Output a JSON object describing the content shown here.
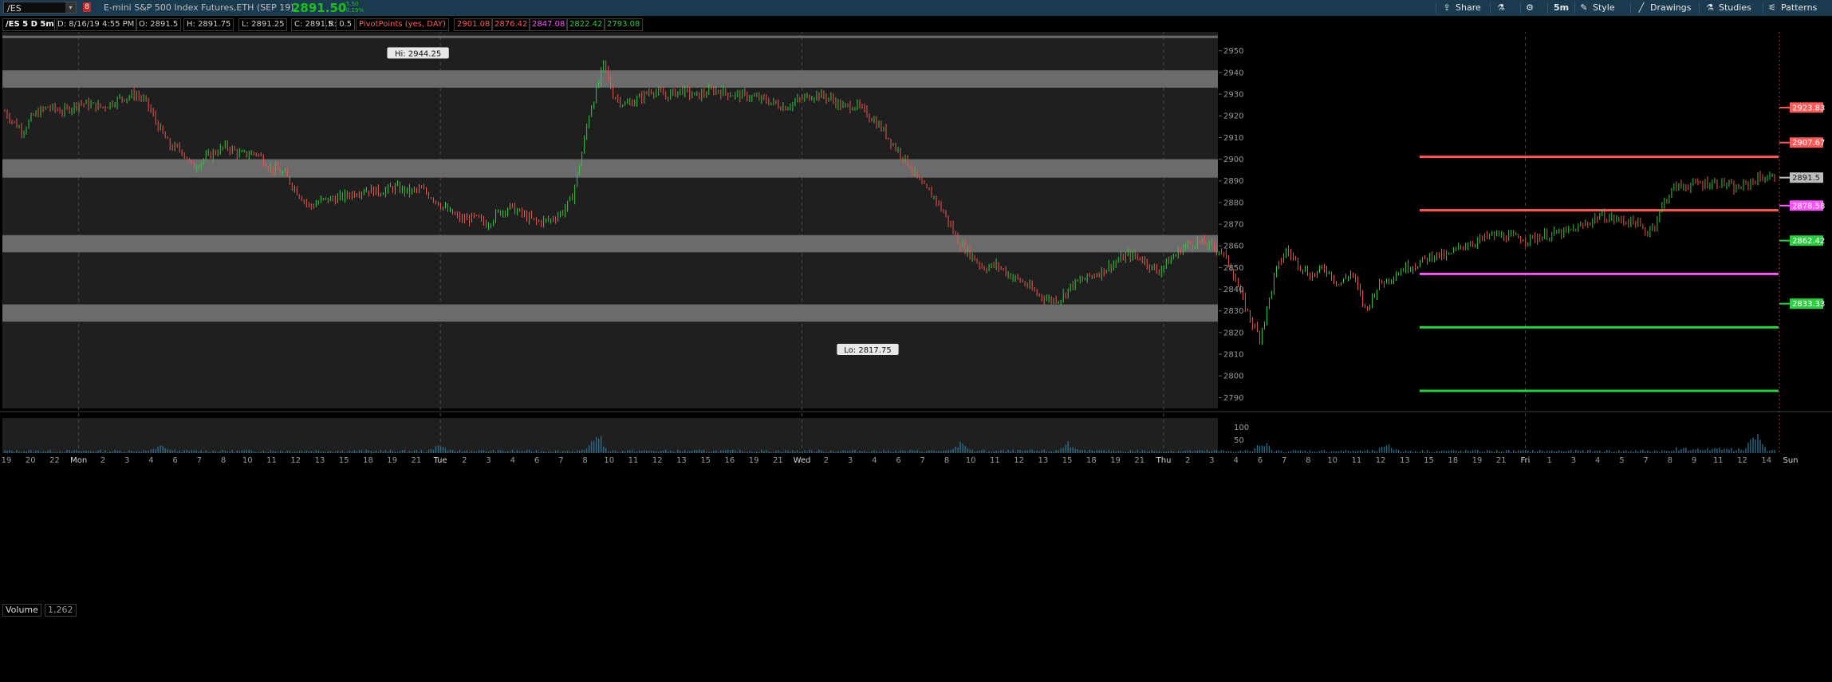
{
  "toolbar": {
    "symbol": "/ES",
    "link_indicator": "8",
    "description": "E-mini S&P 500 Index Futures,ETH (SEP 19)",
    "last_price": "2891.50",
    "net_change": "+5.50",
    "net_change_pct": "+0.19%",
    "share_label": "Share",
    "timeframe_label": "5m",
    "style_label": "Style",
    "drawings_label": "Drawings",
    "studies_label": "Studies",
    "patterns_label": "Patterns"
  },
  "info_bar": {
    "title": "/ES 5 D 5m",
    "date": "D: 8/16/19 4:55 PM",
    "open": "O: 2891.5",
    "high": "H: 2891.75",
    "low": "L: 2891.25",
    "close": "C: 2891.5",
    "range": "R: 0.5",
    "study_name": "PivotPoints (yes, DAY)",
    "pivot_values": [
      {
        "text": "2901.08",
        "color": "#ff5a5a"
      },
      {
        "text": "2876.42",
        "color": "#ff5a5a"
      },
      {
        "text": "2847.08",
        "color": "#ff55ff"
      },
      {
        "text": "2822.42",
        "color": "#2ecc40"
      },
      {
        "text": "2793.08",
        "color": "#2ecc40"
      }
    ]
  },
  "chart_data": {
    "type": "candlestick",
    "symbol": "/ES",
    "interval": "5m",
    "ylim": [
      2785,
      2958
    ],
    "y_ticks": [
      2790,
      2800,
      2810,
      2820,
      2830,
      2840,
      2850,
      2860,
      2870,
      2880,
      2890,
      2900,
      2910,
      2920,
      2930,
      2940,
      2950
    ],
    "grid": "dashed session separators",
    "x_tick_labels": [
      "19",
      "20",
      "22",
      "Mon",
      "2",
      "3",
      "4",
      "6",
      "7",
      "8",
      "10",
      "11",
      "12",
      "13",
      "15",
      "18",
      "19",
      "21",
      "Tue",
      "2",
      "3",
      "4",
      "6",
      "7",
      "8",
      "10",
      "11",
      "12",
      "13",
      "15",
      "16",
      "19",
      "21",
      "Wed",
      "2",
      "3",
      "4",
      "6",
      "7",
      "8",
      "10",
      "11",
      "12",
      "13",
      "15",
      "18",
      "19",
      "21",
      "Thu",
      "2",
      "3",
      "4",
      "6",
      "7",
      "8",
      "10",
      "11",
      "12",
      "13",
      "15",
      "18",
      "19",
      "21",
      "Fri",
      "1",
      "3",
      "4",
      "5",
      "7",
      "8",
      "9",
      "11",
      "12",
      "14",
      "Sun"
    ],
    "session_labels": [
      "Mon",
      "Tue",
      "Wed",
      "Thu",
      "Fri"
    ],
    "price_path": [
      [
        0,
        2922
      ],
      [
        0.4,
        2918
      ],
      [
        1.0,
        2913
      ],
      [
        1.6,
        2920
      ],
      [
        2.4,
        2924
      ],
      [
        3.3,
        2922
      ],
      [
        4.2,
        2926
      ],
      [
        5.5,
        2924
      ],
      [
        6.5,
        2928
      ],
      [
        7.4,
        2930
      ],
      [
        8.0,
        2926
      ],
      [
        8.6,
        2916
      ],
      [
        9.3,
        2906
      ],
      [
        10.0,
        2904
      ],
      [
        10.6,
        2896
      ],
      [
        11.2,
        2900
      ],
      [
        11.8,
        2903
      ],
      [
        12.5,
        2906
      ],
      [
        13.3,
        2902
      ],
      [
        14.2,
        2903
      ],
      [
        15.0,
        2896
      ],
      [
        15.8,
        2893
      ],
      [
        16.5,
        2885
      ],
      [
        17.2,
        2878
      ],
      [
        17.9,
        2881
      ],
      [
        18.8,
        2882
      ],
      [
        19.5,
        2884
      ],
      [
        20.3,
        2886
      ],
      [
        21.2,
        2885
      ],
      [
        22.0,
        2887
      ],
      [
        22.8,
        2885
      ],
      [
        23.5,
        2886
      ],
      [
        24.2,
        2882
      ],
      [
        25.0,
        2876
      ],
      [
        25.8,
        2872
      ],
      [
        26.5,
        2873
      ],
      [
        27.2,
        2870
      ],
      [
        27.8,
        2875
      ],
      [
        28.5,
        2878
      ],
      [
        29.3,
        2874
      ],
      [
        30.0,
        2871
      ],
      [
        30.8,
        2872
      ],
      [
        31.5,
        2876
      ],
      [
        32.0,
        2882
      ],
      [
        32.5,
        2900
      ],
      [
        33.0,
        2922
      ],
      [
        33.4,
        2932
      ],
      [
        33.8,
        2944.25
      ],
      [
        34.3,
        2930
      ],
      [
        35.0,
        2925
      ],
      [
        35.8,
        2928
      ],
      [
        36.5,
        2932
      ],
      [
        37.3,
        2929
      ],
      [
        38.2,
        2932
      ],
      [
        39.0,
        2929
      ],
      [
        40.0,
        2932
      ],
      [
        41.0,
        2930
      ],
      [
        42.0,
        2929
      ],
      [
        43.0,
        2927
      ],
      [
        44.0,
        2924
      ],
      [
        45.0,
        2928
      ],
      [
        45.8,
        2930
      ],
      [
        46.6,
        2928
      ],
      [
        47.3,
        2924
      ],
      [
        48.0,
        2925
      ],
      [
        48.8,
        2920
      ],
      [
        49.5,
        2914
      ],
      [
        50.2,
        2906
      ],
      [
        51.0,
        2898
      ],
      [
        51.7,
        2888
      ],
      [
        52.5,
        2882
      ],
      [
        53.2,
        2872
      ],
      [
        53.8,
        2862
      ],
      [
        54.5,
        2856
      ],
      [
        55.2,
        2850
      ],
      [
        56.0,
        2851
      ],
      [
        56.8,
        2846
      ],
      [
        57.5,
        2843
      ],
      [
        58.2,
        2838
      ],
      [
        59.0,
        2835
      ],
      [
        59.6,
        2836
      ],
      [
        60.2,
        2842
      ],
      [
        61.0,
        2845
      ],
      [
        61.8,
        2848
      ],
      [
        62.6,
        2852
      ],
      [
        63.4,
        2856
      ],
      [
        64.2,
        2854
      ],
      [
        65.0,
        2848
      ],
      [
        65.8,
        2854
      ],
      [
        66.6,
        2860
      ],
      [
        67.3,
        2862
      ],
      [
        68.0,
        2860
      ],
      [
        68.6,
        2858
      ],
      [
        69.2,
        2850
      ],
      [
        69.8,
        2836
      ],
      [
        70.3,
        2826
      ],
      [
        70.8,
        2817.75
      ],
      [
        71.2,
        2830
      ],
      [
        71.7,
        2848
      ],
      [
        72.3,
        2858
      ],
      [
        73.0,
        2852
      ],
      [
        73.7,
        2846
      ],
      [
        74.5,
        2850
      ],
      [
        75.3,
        2842
      ],
      [
        76.0,
        2848
      ],
      [
        76.8,
        2830
      ],
      [
        77.5,
        2842
      ],
      [
        78.3,
        2846
      ],
      [
        79.0,
        2850
      ],
      [
        79.8,
        2852
      ],
      [
        80.6,
        2856
      ],
      [
        81.4,
        2855
      ],
      [
        82.2,
        2860
      ],
      [
        83.0,
        2862
      ],
      [
        84.0,
        2865
      ],
      [
        85.0,
        2864
      ],
      [
        86.0,
        2863
      ],
      [
        87.0,
        2865
      ],
      [
        88.0,
        2866
      ],
      [
        89.0,
        2869
      ],
      [
        90.0,
        2874
      ],
      [
        91.0,
        2872
      ],
      [
        92.0,
        2871
      ],
      [
        92.6,
        2866
      ],
      [
        93.1,
        2870
      ],
      [
        93.6,
        2880
      ],
      [
        94.2,
        2887
      ],
      [
        95.0,
        2888
      ],
      [
        96.0,
        2889
      ],
      [
        97.0,
        2889
      ],
      [
        97.6,
        2886
      ],
      [
        98.2,
        2888
      ],
      [
        99.0,
        2891.5
      ],
      [
        100,
        2891.5
      ]
    ],
    "swing_labels": [
      {
        "text": "Hi: 2944.25",
        "x": 33.8,
        "value": 2944.25
      },
      {
        "text": "Lo: 2817.75",
        "x": 70.8,
        "value": 2817.75
      }
    ],
    "zones": [
      {
        "from": 2956,
        "to": 2957
      },
      {
        "from": 2933,
        "to": 2941
      },
      {
        "from": 2891.5,
        "to": 2900
      },
      {
        "from": 2857,
        "to": 2865
      },
      {
        "from": 2825,
        "to": 2833
      }
    ],
    "pivot_lines": [
      {
        "value": 2901.08,
        "color": "#ff5a5a"
      },
      {
        "value": 2876.42,
        "color": "#ff5a5a"
      },
      {
        "value": 2847.08,
        "color": "#ff55ff"
      },
      {
        "value": 2822.42,
        "color": "#2ecc40"
      },
      {
        "value": 2793.08,
        "color": "#2ecc40"
      }
    ],
    "price_badges": [
      {
        "text": "2923.83",
        "value": 2923.83,
        "color": "#ff5a5a"
      },
      {
        "text": "2907.67",
        "value": 2907.67,
        "color": "#ff5a5a"
      },
      {
        "text": "2891.5",
        "value": 2891.5,
        "color": "#bdbdbd"
      },
      {
        "text": "2878.58",
        "value": 2878.58,
        "color": "#ff55ff"
      },
      {
        "text": "2862.42",
        "value": 2862.42,
        "color": "#2ecc40"
      },
      {
        "text": "2833.33",
        "value": 2833.33,
        "color": "#2ecc40"
      }
    ],
    "volume": {
      "label": "Volume",
      "last_value": "1,262",
      "ylim": [
        0,
        110
      ],
      "y_ticks": [
        50,
        100
      ]
    }
  }
}
